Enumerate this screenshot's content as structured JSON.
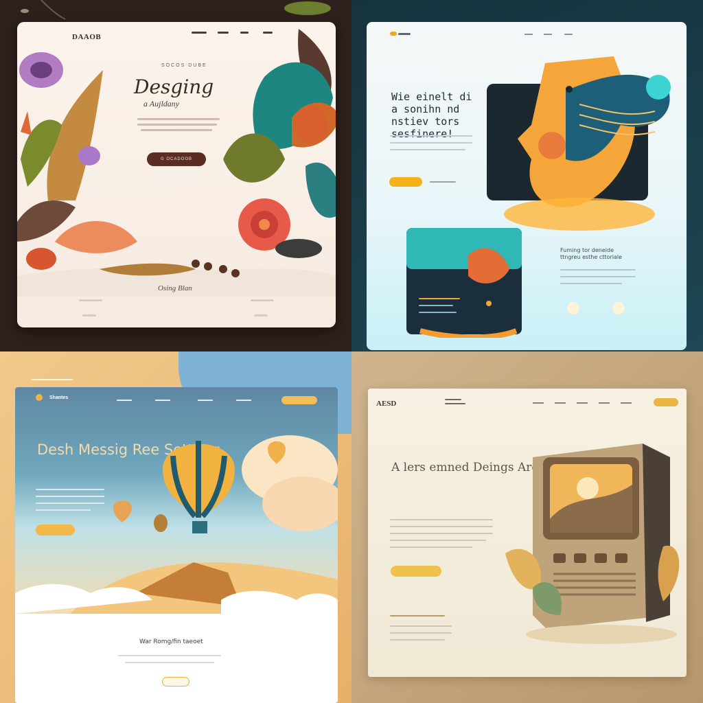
{
  "mockups": [
    {
      "logo": "DAAOB",
      "kicker": "SOCOS DUBE",
      "title": "Desging",
      "subtitle": "a Aujldany",
      "button_label": "G OCADOOB",
      "signature": "Osing Blan",
      "colors": {
        "accent": "#5a2c22",
        "background": "#2e201c",
        "card": "#fbf3ec"
      }
    },
    {
      "title": "Wie einelt di a sonihn nd nstiev tors sesfinere!",
      "subheading": "Fuming tor deneide ttngreu esthe cttoriale",
      "colors": {
        "accent": "#f3b11b",
        "background": "#16333d"
      }
    },
    {
      "logo": "Shantes",
      "title": "Desh Messig Ree Setteng",
      "section_heading": "War Romg/fin taeoet",
      "colors": {
        "accent": "#f2b84a",
        "sky": "#5f87a3",
        "background": "#f1c98a"
      }
    },
    {
      "logo": "AESD",
      "title": "A lers emned Deings Areg De geimtge 6l",
      "colors": {
        "accent": "#efc24e",
        "background": "#cfb48e",
        "card": "#f6f1e2"
      }
    }
  ]
}
